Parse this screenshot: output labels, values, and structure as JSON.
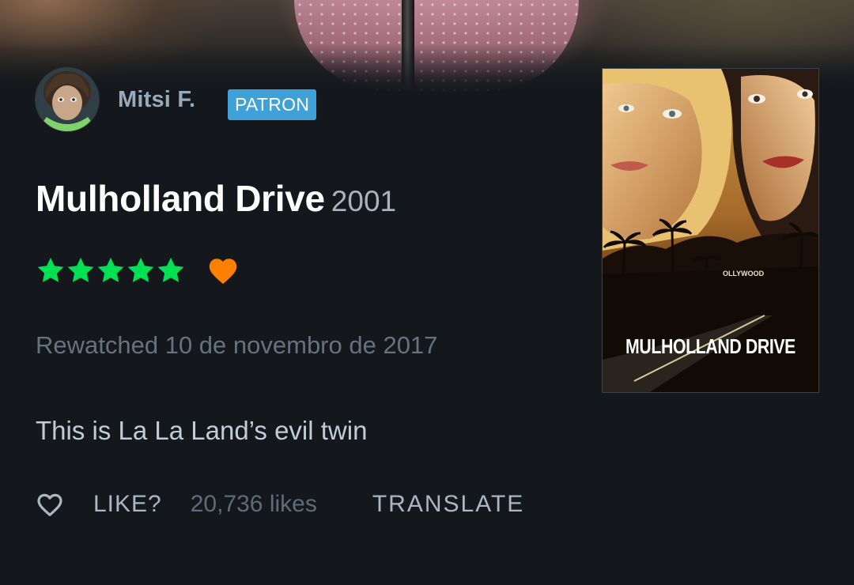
{
  "review": {
    "author": {
      "name": "Mitsi F.",
      "badge": "PATRON"
    },
    "film": {
      "title": "Mulholland Drive",
      "year": "2001",
      "poster_title": "MULHOLLAND DRIVE",
      "poster_sign": "OLLYWOOD"
    },
    "rating": {
      "stars": 5,
      "max_stars": 5,
      "liked": true
    },
    "watched_line": "Rewatched 10 de novembro de 2017",
    "body": "This is La La Land’s evil twin",
    "actions": {
      "like_label": "LIKE?",
      "likes_count": "20,736 likes",
      "translate_label": "TRANSLATE"
    }
  },
  "icons": {
    "star": "star-icon",
    "liked_heart": "heart-filled-icon",
    "like_button": "heart-outline-icon"
  },
  "colors": {
    "background": "#14181c",
    "star_green": "#00e054",
    "liked_orange": "#ff8000",
    "patron_blue": "#40a0d8",
    "title_white": "#ffffff",
    "muted_text": "#66727e"
  }
}
